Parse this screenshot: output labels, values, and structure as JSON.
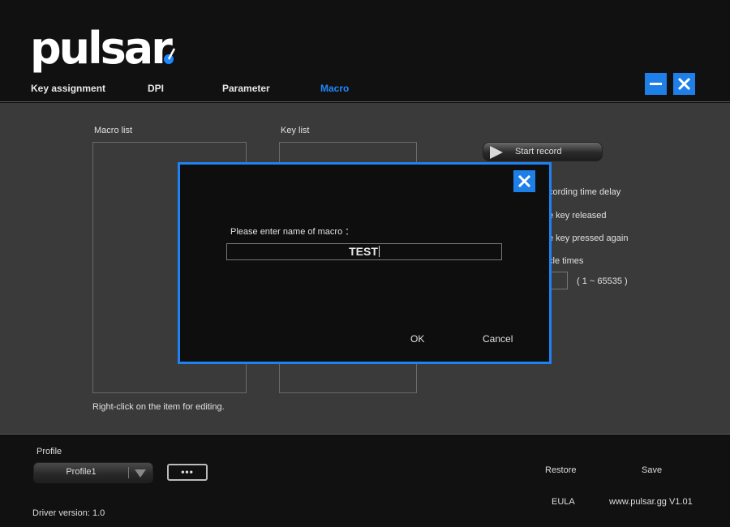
{
  "app": {
    "logo_text": "pulsar",
    "tabs": [
      {
        "label": "Key assignment"
      },
      {
        "label": "DPI"
      },
      {
        "label": "Parameter"
      },
      {
        "label": "Macro"
      }
    ],
    "active_tab": "Macro",
    "accent_color": "#1e82f0"
  },
  "macro": {
    "macro_list_label": "Macro list",
    "key_list_label": "Key list",
    "start_record_label": "Start record",
    "options": [
      "cording time delay",
      "e key released",
      "e key pressed again",
      "cle times"
    ],
    "cycle_range": "( 1 ~ 65535 )",
    "hint": "Right-click on the item for editing."
  },
  "dialog": {
    "prompt": "Please enter name of macro ：",
    "input_value": "TEST",
    "ok_label": "OK",
    "cancel_label": "Cancel"
  },
  "footer": {
    "profile_label": "Profile",
    "profile_value": "Profile1",
    "more_label": "•••",
    "driver_version": "Driver version:  1.0",
    "restore_label": "Restore",
    "save_label": "Save",
    "eula_label": "EULA",
    "site_version": "www.pulsar.gg  V1.01"
  }
}
